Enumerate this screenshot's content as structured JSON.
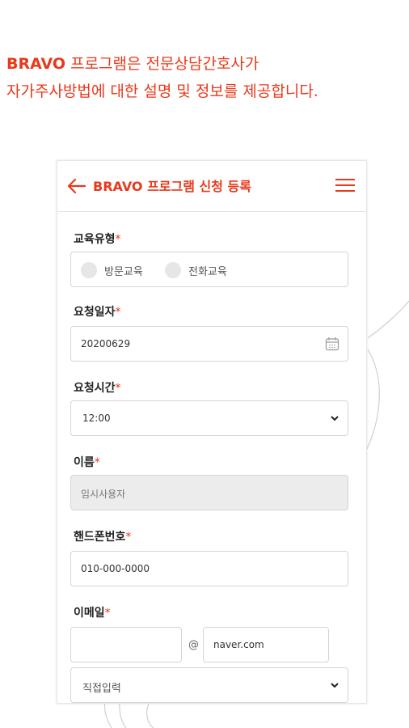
{
  "headline": {
    "brand": "BRAVO",
    "line1_rest": " 프로그램은 전문상담간호사가",
    "line2": "자가주사방법에 대한 설명 및 정보를 제공합니다."
  },
  "appbar": {
    "title": "BRAVO 프로그램 신청 등록"
  },
  "form": {
    "required_mark": "*",
    "education_type": {
      "label": "교육유형",
      "options": [
        "방문교육",
        "전화교육"
      ]
    },
    "request_date": {
      "label": "요청일자",
      "value": "20200629"
    },
    "request_time": {
      "label": "요청시간",
      "value": "12:00"
    },
    "name": {
      "label": "이름",
      "value": "임시사용자"
    },
    "phone": {
      "label": "핸드폰번호",
      "value": "010-000-0000"
    },
    "email": {
      "label": "이메일",
      "local_value": "",
      "at": "@",
      "domain_value": "naver.com",
      "domain_select": "직접입력"
    }
  },
  "colors": {
    "accent": "#e8391b",
    "disabled_bg": "#ececec"
  }
}
